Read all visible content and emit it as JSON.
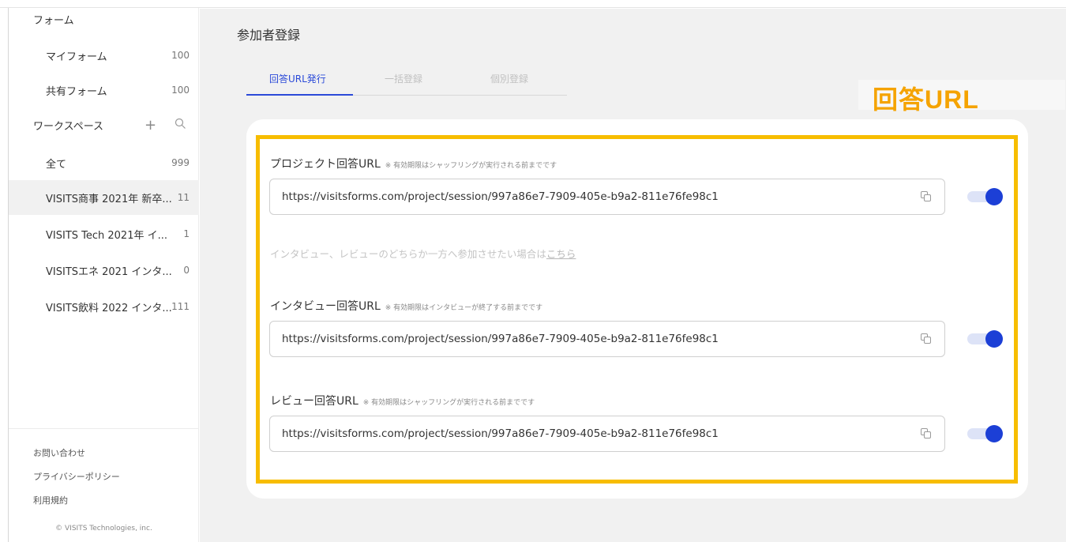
{
  "sidebar": {
    "section_form": "フォーム",
    "my_forms": {
      "label": "マイフォーム",
      "count": "100"
    },
    "shared_forms": {
      "label": "共有フォーム",
      "count": "100"
    },
    "workspace": {
      "label": "ワークスペース",
      "add_icon": "plus-icon",
      "search_icon": "search-icon"
    },
    "items": [
      {
        "label": "全て",
        "count": "999"
      },
      {
        "label": "VISITS商事 2021年 新卒...",
        "count": "11"
      },
      {
        "label": "VISITS Tech 2021年 イ...",
        "count": "1"
      },
      {
        "label": "VISITSエネ 2021 インタ...",
        "count": "0"
      },
      {
        "label": "VISITS飲料 2022 インタ...",
        "count": "111"
      }
    ],
    "footer": {
      "contact": "お問い合わせ",
      "privacy": "プライバシーポリシー",
      "terms": "利用規約",
      "copyright": "© VISITS Technologies, inc."
    }
  },
  "main": {
    "title": "参加者登録",
    "tabs": [
      {
        "label": "回答URL発行"
      },
      {
        "label": "一括登録"
      },
      {
        "label": "個別登録"
      }
    ],
    "annotation": "回答URL",
    "sections": [
      {
        "title": "プロジェクト回答URL",
        "note": "※ 有効期限はシャッフリングが実行される前までです",
        "url": "https://visitsforms.com/project/session/997a86e7-7909-405e-b9a2-811e76fe98c1",
        "enabled": true
      },
      {
        "title": "インタビュー回答URL",
        "note": "※ 有効期限はインタビューが終了する前までです",
        "url": "https://visitsforms.com/project/session/997a86e7-7909-405e-b9a2-811e76fe98c1",
        "enabled": true
      },
      {
        "title": "レビュー回答URL",
        "note": "※ 有効期限はシャッフリングが実行される前までです",
        "url": "https://visitsforms.com/project/session/997a86e7-7909-405e-b9a2-811e76fe98c1",
        "enabled": true
      }
    ],
    "hint": {
      "text": "インタビュー、レビューのどちらか一方へ参加させたい場合は",
      "link": "こちら"
    }
  },
  "colors": {
    "accent": "#1c3fd6",
    "highlight": "#f7bd00",
    "annotation": "#f5a300"
  }
}
